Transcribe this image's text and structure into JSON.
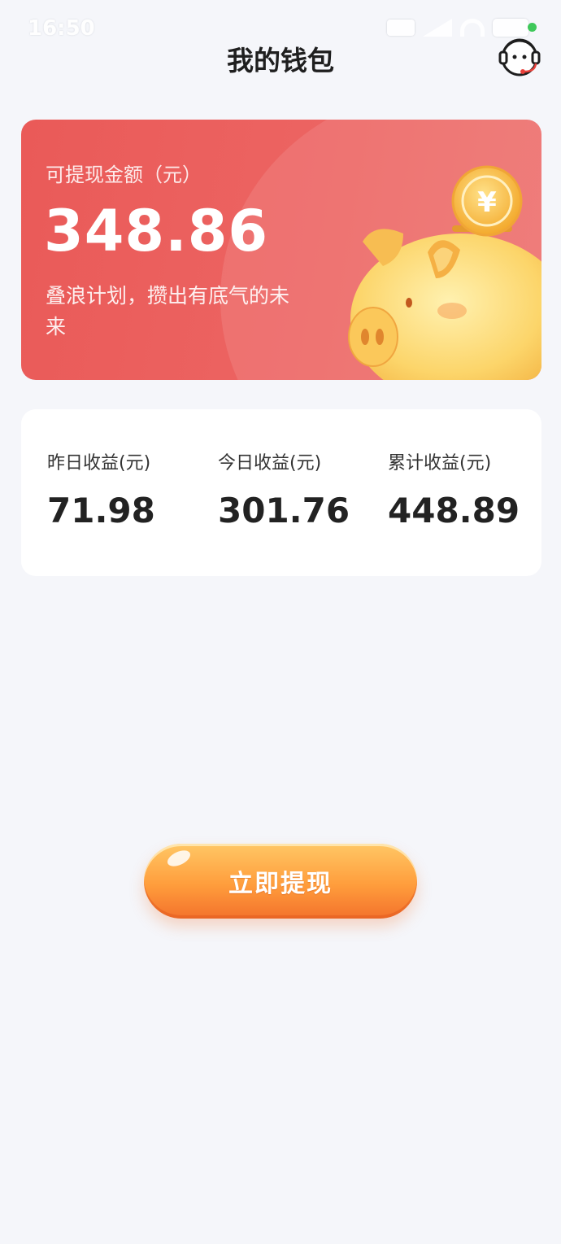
{
  "status_bar": {
    "time": "16:50"
  },
  "header": {
    "title": "我的钱包"
  },
  "balance": {
    "label": "可提现金额（元）",
    "amount": "348.86",
    "slogan": "叠浪计划，攒出有底气的未来"
  },
  "stats": [
    {
      "label": "昨日收益(元)",
      "value": "71.98"
    },
    {
      "label": "今日收益(元)",
      "value": "301.76"
    },
    {
      "label": "累计收益(元)",
      "value": "448.89"
    }
  ],
  "withdraw": {
    "label": "立即提现"
  },
  "colors": {
    "card_red": "#ea5a58",
    "button_orange": "#ff9d3c",
    "coin_gold": "#f9c33b",
    "status_green": "#3fc85a"
  },
  "icons": [
    "customer-service-icon",
    "piggy-bank-icon",
    "yuan-coin-icon",
    "signal-icon",
    "wifi-icon",
    "battery-icon"
  ]
}
